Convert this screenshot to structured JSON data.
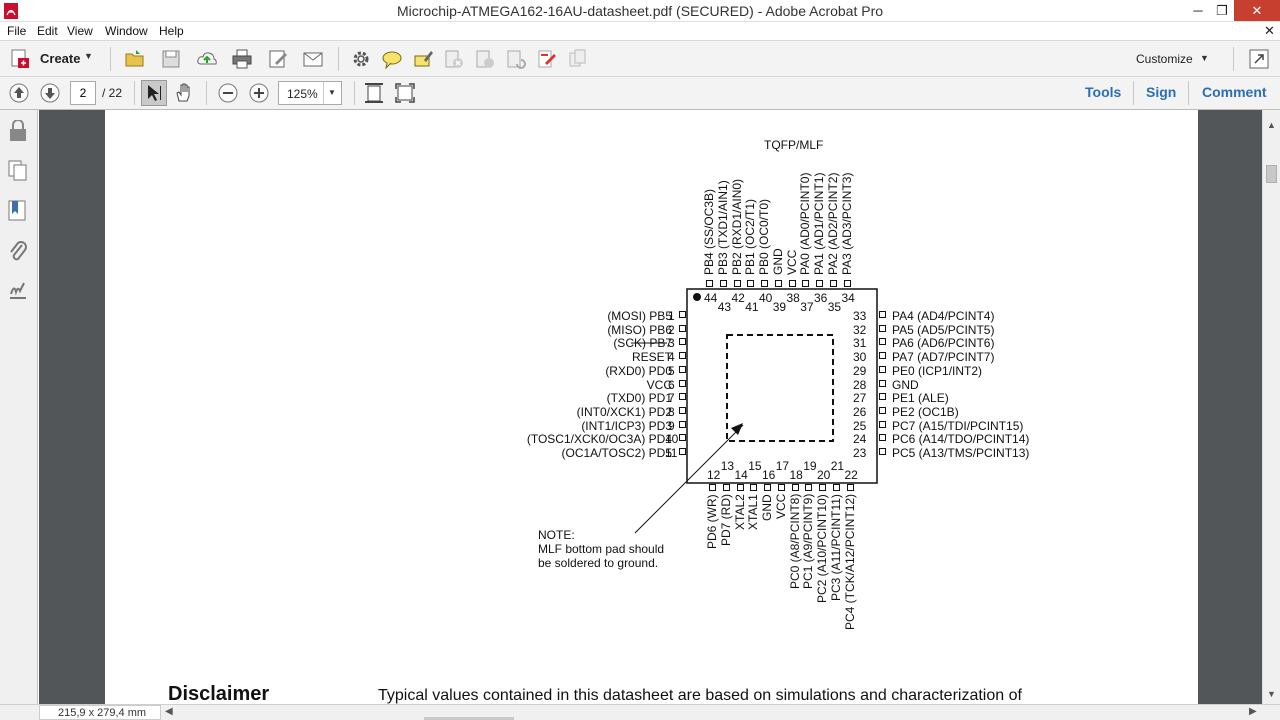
{
  "window": {
    "title": "Microchip-ATMEGA162-16AU-datasheet.pdf (SECURED) - Adobe Acrobat Pro",
    "minimize_glyph": "─",
    "restore_glyph": "❐",
    "close_glyph": "✕",
    "doc_close_glyph": "✕"
  },
  "menu": {
    "items": [
      "File",
      "Edit",
      "View",
      "Window",
      "Help"
    ]
  },
  "toolbar": {
    "create_label": "Create",
    "customize_label": "Customize"
  },
  "nav": {
    "page_value": "2",
    "page_total": "/ 22",
    "zoom_value": "125%",
    "tools_label": "Tools",
    "sign_label": "Sign",
    "comment_label": "Comment"
  },
  "status": {
    "page_size": "215,9 x 279,4 mm"
  },
  "document": {
    "package_label": "TQFP/MLF",
    "note_lines": [
      "NOTE:",
      "MLF bottom pad should",
      "be soldered to ground."
    ],
    "disclaimer_heading": "Disclaimer",
    "disclaimer_text": "Typical values contained in this datasheet are based on simulations and characterization of",
    "pins_left": [
      {
        "num": "1",
        "label": "(MOSI)  PB5"
      },
      {
        "num": "2",
        "label": "(MISO)  PB6"
      },
      {
        "num": "3",
        "label": "(SCK)  PB7"
      },
      {
        "num": "4",
        "label": "RESET"
      },
      {
        "num": "5",
        "label": "(RXD0)  PD0"
      },
      {
        "num": "6",
        "label": "VCC"
      },
      {
        "num": "7",
        "label": "(TXD0)  PD1"
      },
      {
        "num": "8",
        "label": "(INT0/XCK1)  PD2"
      },
      {
        "num": "9",
        "label": "(INT1/ICP3)  PD3"
      },
      {
        "num": "10",
        "label": "(TOSC1/XCK0/OC3A)  PD4"
      },
      {
        "num": "11",
        "label": "(OC1A/TOSC2)  PD5"
      }
    ],
    "pins_right": [
      {
        "num": "33",
        "label": "PA4  (AD4/PCINT4)"
      },
      {
        "num": "32",
        "label": "PA5  (AD5/PCINT5)"
      },
      {
        "num": "31",
        "label": "PA6  (AD6/PCINT6)"
      },
      {
        "num": "30",
        "label": "PA7  (AD7/PCINT7)"
      },
      {
        "num": "29",
        "label": "PE0  (ICP1/INT2)"
      },
      {
        "num": "28",
        "label": "GND"
      },
      {
        "num": "27",
        "label": "PE1  (ALE)"
      },
      {
        "num": "26",
        "label": "PE2  (OC1B)"
      },
      {
        "num": "25",
        "label": "PC7  (A15/TDI/PCINT15)"
      },
      {
        "num": "24",
        "label": "PC6  (A14/TDO/PCINT14)"
      },
      {
        "num": "23",
        "label": "PC5  (A13/TMS/PCINT13)"
      }
    ],
    "pins_top": [
      {
        "num": "44",
        "label": "PB4  (SS/OC3B)"
      },
      {
        "num": "43",
        "label": "PB3  (TXD1/AIN1)"
      },
      {
        "num": "42",
        "label": "PB2  (RXD1/AIN0)"
      },
      {
        "num": "41",
        "label": "PB1  (OC2/T1)"
      },
      {
        "num": "40",
        "label": "PB0  (OC0/T0)"
      },
      {
        "num": "39",
        "label": "GND"
      },
      {
        "num": "38",
        "label": "VCC"
      },
      {
        "num": "37",
        "label": "PA0  (AD0/PCINT0)"
      },
      {
        "num": "36",
        "label": "PA1  (AD1/PCINT1)"
      },
      {
        "num": "35",
        "label": "PA2  (AD2/PCINT2)"
      },
      {
        "num": "34",
        "label": "PA3  (AD3/PCINT3)"
      }
    ],
    "pins_bottom": [
      {
        "num": "12",
        "label": "PD6  (WR)"
      },
      {
        "num": "13",
        "label": "PD7  (RD)"
      },
      {
        "num": "14",
        "label": "XTAL2"
      },
      {
        "num": "15",
        "label": "XTAL1"
      },
      {
        "num": "16",
        "label": "GND"
      },
      {
        "num": "17",
        "label": "VCC"
      },
      {
        "num": "18",
        "label": "PC0  (A8/PCINT8)"
      },
      {
        "num": "19",
        "label": "PC1  (A9/PCINT9)"
      },
      {
        "num": "20",
        "label": "PC2  (A10/PCINT10)"
      },
      {
        "num": "21",
        "label": "PC3  (A11/PCINT11)"
      },
      {
        "num": "22",
        "label": "PC4  (TCK/A12/PCINT12)"
      }
    ]
  },
  "colors": {
    "accent": "#2a6fb5",
    "doc_background": "#525659",
    "toolbar_bg": "#f3f3f3"
  },
  "icons": {
    "left_panel": [
      "lock-icon",
      "pages-icon",
      "bookmark-icon",
      "attachment-icon",
      "signature-icon"
    ]
  }
}
